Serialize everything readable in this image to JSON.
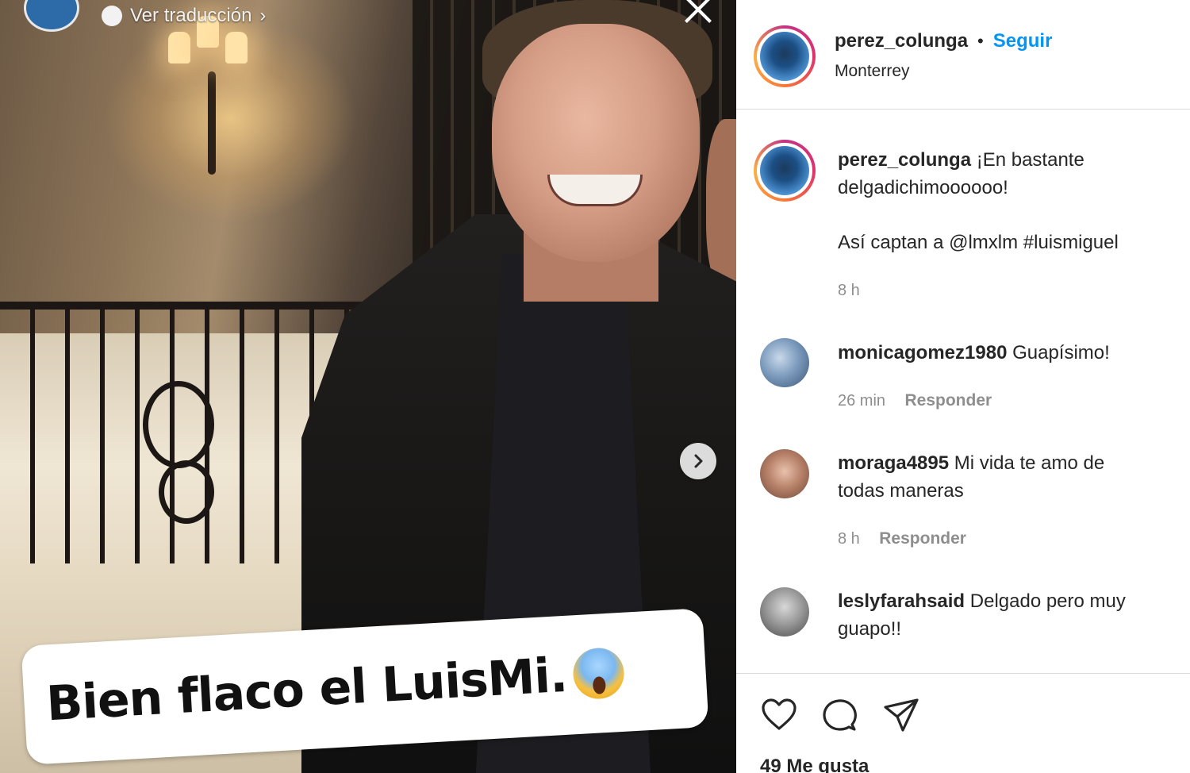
{
  "media": {
    "translate_label": "Ver traducción",
    "translate_chevron": "›",
    "caption": "Bien flaco el LuisMi.",
    "caption_emoji": "screaming-face-emoji",
    "close_icon": "close-icon",
    "next_icon": "chevron-right-icon"
  },
  "post": {
    "username": "perez_colunga",
    "separator": "•",
    "follow_label": "Seguir",
    "location": "Monterrey",
    "caption_line1": "¡En bastante",
    "caption_line2": "delgadichimoooooo!",
    "caption_tags": "Así captan a @lmxlm #luismiguel",
    "time": "8 h"
  },
  "comments": [
    {
      "username": "monicagomez1980",
      "text": "Guapísimo!",
      "text_line2": "",
      "time": "26 min",
      "reply_label": "Responder"
    },
    {
      "username": "moraga4895",
      "text": "Mi vida te amo de",
      "text_line2": "todas maneras",
      "time": "8 h",
      "reply_label": "Responder"
    },
    {
      "username": "leslyfarahsaid",
      "text": "Delgado pero muy",
      "text_line2": "guapo!!"
    }
  ],
  "actions": {
    "like_icon": "heart-icon",
    "comment_icon": "comment-icon",
    "share_icon": "paper-plane-icon",
    "likes": "49 Me gusta"
  },
  "colors": {
    "accent": "#0095f6",
    "text": "#262626",
    "muted": "#8e8e8e",
    "divider": "#dbdbdb"
  }
}
